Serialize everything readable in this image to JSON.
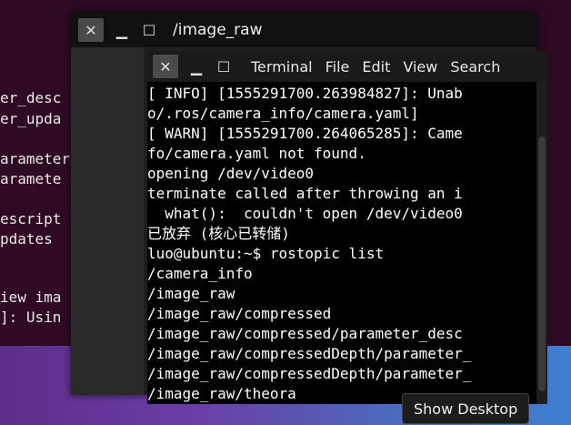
{
  "background_terminal": {
    "lines": [
      "er_desc",
      "er_upda",
      "",
      "arameter",
      "aramete r",
      "",
      "escript",
      "pdates",
      "",
      "",
      "iew ima",
      "]: Usin"
    ]
  },
  "image_window": {
    "title": "/image_raw",
    "controls": {
      "close": "✕",
      "minimize": "▁",
      "maximize": "☐"
    }
  },
  "terminal": {
    "menu": [
      "Terminal",
      "File",
      "Edit",
      "View",
      "Search"
    ],
    "controls": {
      "close": "✕",
      "minimize": "▁",
      "maximize": "☐"
    },
    "lines": [
      {
        "text": "[ INFO] [1555291700.263984827]: Unab",
        "style": "normal"
      },
      {
        "text": "o/.ros/camera_info/camera.yaml]",
        "style": "normal"
      },
      {
        "text": "[ WARN] [1555291700.264065285]: Came",
        "style": "dim"
      },
      {
        "text": "fo/camera.yaml not found.",
        "style": "dim"
      },
      {
        "text": "opening /dev/video0",
        "style": "normal"
      },
      {
        "text": "terminate called after throwing an i",
        "style": "normal"
      },
      {
        "text": "  what():  couldn't open /dev/video0",
        "style": "normal"
      },
      {
        "text": "已放弃 (核心已转储)",
        "style": "normal"
      },
      {
        "text": "luo@ubuntu:~$ rostopic list",
        "style": "prompt"
      },
      {
        "text": "/camera_info",
        "style": "normal"
      },
      {
        "text": "/image_raw",
        "style": "normal"
      },
      {
        "text": "/image_raw/compressed",
        "style": "normal"
      },
      {
        "text": "/image_raw/compressed/parameter_desc",
        "style": "normal"
      },
      {
        "text": "/image_raw/compressedDepth/parameter_",
        "style": "normal"
      },
      {
        "text": "/image_raw/compressedDepth/parameter_",
        "style": "normal"
      },
      {
        "text": "/image_raw/theora",
        "style": "normal"
      }
    ]
  },
  "taskbar": {
    "show_desktop": "Show Desktop"
  }
}
